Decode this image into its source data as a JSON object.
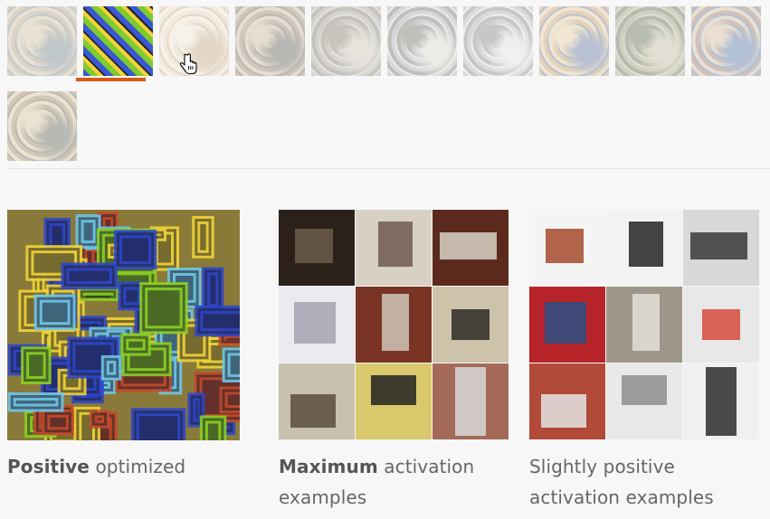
{
  "thumbnails": [
    {
      "name": "thumb-1",
      "colors": [
        "#b9a78d",
        "#7f8f93",
        "#d8c7a8"
      ]
    },
    {
      "name": "thumb-2",
      "colors": [
        "#3a57d6",
        "#7ecb2e",
        "#f2d23a"
      ],
      "selected": true
    },
    {
      "name": "thumb-3",
      "colors": [
        "#e9d8c0",
        "#c9ad86",
        "#f4ead9"
      ]
    },
    {
      "name": "thumb-4",
      "colors": [
        "#9e8c70",
        "#6f6a62",
        "#cfc1a6"
      ]
    },
    {
      "name": "thumb-5",
      "colors": [
        "#a7a7a3",
        "#d0cabc",
        "#8c8373"
      ]
    },
    {
      "name": "thumb-6",
      "colors": [
        "#a9b2bf",
        "#e0dccf",
        "#7e7a72"
      ]
    },
    {
      "name": "thumb-7",
      "colors": [
        "#b8b8b8",
        "#e6e6e6",
        "#8c8c8c"
      ]
    },
    {
      "name": "thumb-8",
      "colors": [
        "#cfa56e",
        "#6b7ea8",
        "#e8d1a5"
      ]
    },
    {
      "name": "thumb-9",
      "colors": [
        "#a0a57d",
        "#c9c2a8",
        "#6c715c"
      ]
    },
    {
      "name": "thumb-10",
      "colors": [
        "#a27f6e",
        "#5e7fb0",
        "#d7c3a4"
      ]
    },
    {
      "name": "thumb-11",
      "colors": [
        "#a88f62",
        "#6d6e62",
        "#d9c9a2"
      ]
    }
  ],
  "positive_optimized": {
    "caption_bold": "Positive",
    "caption_rest": " optimized",
    "colors": [
      "#2d46c9",
      "#89d021",
      "#f0d437",
      "#c24a2a",
      "#6fc5e8"
    ]
  },
  "maximum_activation": {
    "caption_bold": "Maximum",
    "caption_rest": " activation examples",
    "cells": [
      {
        "bg": "#2b2118",
        "fg": "#6b5a49"
      },
      {
        "bg": "#d7d0c3",
        "fg": "#6e5a4f"
      },
      {
        "bg": "#5b2a1c",
        "fg": "#d8d2c4"
      },
      {
        "bg": "#ece9ef",
        "fg": "#a6a2b2"
      },
      {
        "bg": "#7a3424",
        "fg": "#cfc7b8"
      },
      {
        "bg": "#cdc3ab",
        "fg": "#2d2a25"
      },
      {
        "bg": "#c7c1ae",
        "fg": "#5a4c3e"
      },
      {
        "bg": "#d9c96c",
        "fg": "#222222"
      },
      {
        "bg": "#a36a58",
        "fg": "#d8d8d8"
      }
    ]
  },
  "slightly_positive": {
    "caption_line1": "Slightly positive",
    "caption_line2": "activation examples",
    "cells": [
      {
        "bg": "#f4f4f4",
        "fg": "#a54a2c"
      },
      {
        "bg": "#f2f2f2",
        "fg": "#242424"
      },
      {
        "bg": "#d8d8d8",
        "fg": "#3a3a3a"
      },
      {
        "bg": "#b6242a",
        "fg": "#2a4f85"
      },
      {
        "bg": "#9e968a",
        "fg": "#e4e0d8"
      },
      {
        "bg": "#e8e8e8",
        "fg": "#d54b3c"
      },
      {
        "bg": "#b24a3a",
        "fg": "#e4e4e4"
      },
      {
        "bg": "#e9e9e9",
        "fg": "#8d8d8d"
      },
      {
        "bg": "#f0f0f0",
        "fg": "#2b2b2b"
      }
    ]
  }
}
